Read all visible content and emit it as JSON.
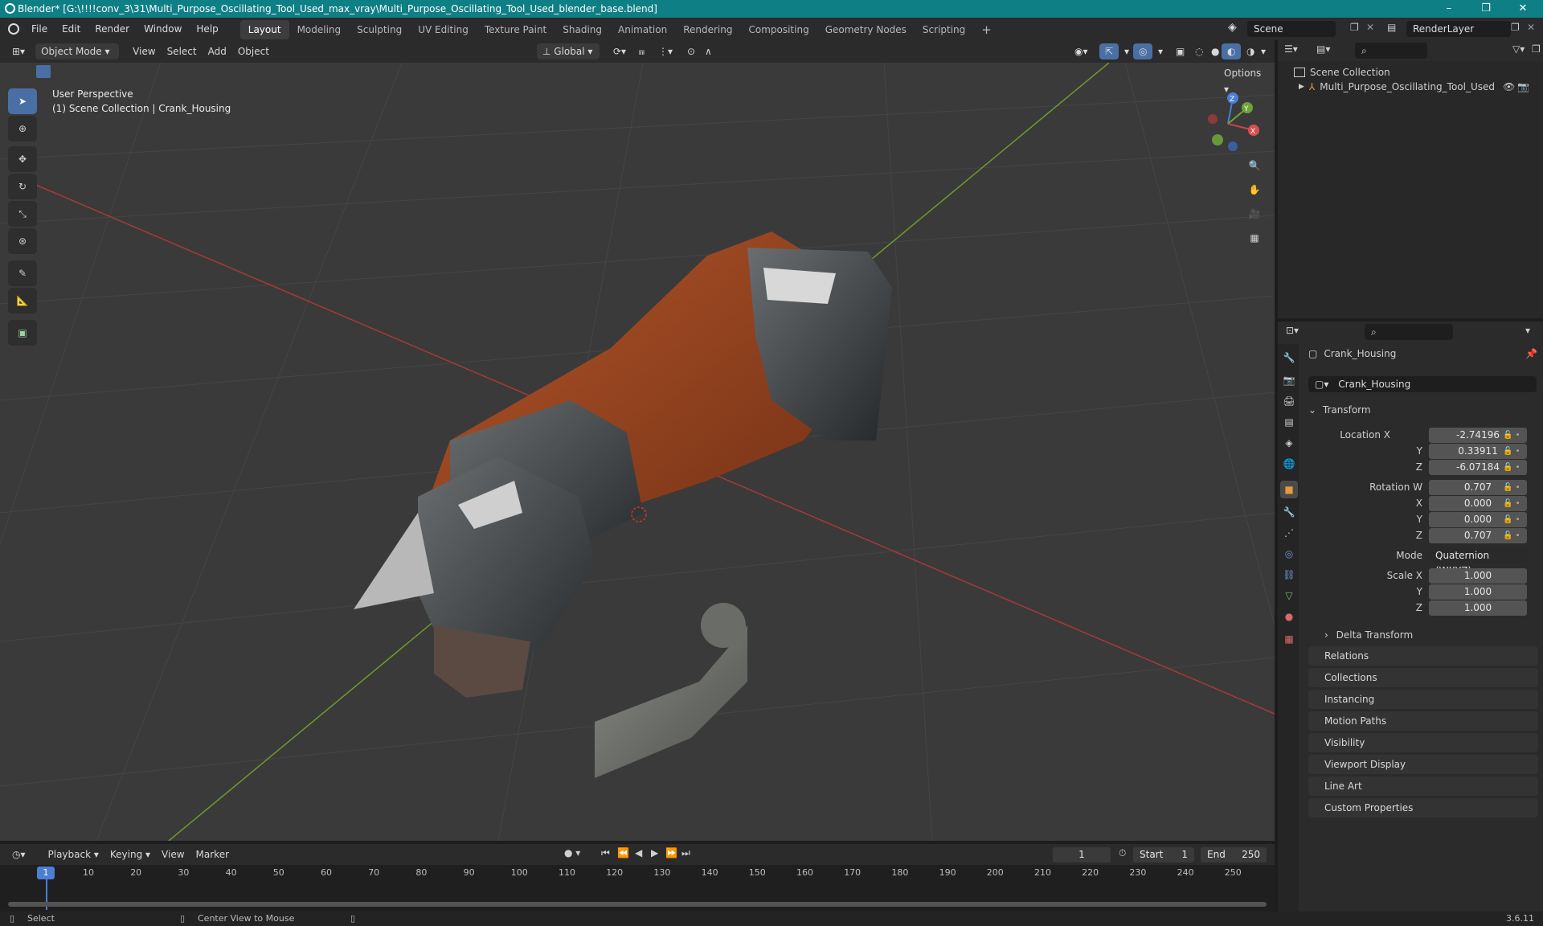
{
  "window": {
    "title": "Blender* [G:\\!!!!conv_3\\31\\Multi_Purpose_Oscillating_Tool_Used_max_vray\\Multi_Purpose_Oscillating_Tool_Used_blender_base.blend]",
    "controls": [
      "–",
      "❐",
      "✕"
    ]
  },
  "menubar": {
    "items": [
      "File",
      "Edit",
      "Render",
      "Window",
      "Help"
    ],
    "workspaces": [
      "Layout",
      "Modeling",
      "Sculpting",
      "UV Editing",
      "Texture Paint",
      "Shading",
      "Animation",
      "Rendering",
      "Compositing",
      "Geometry Nodes",
      "Scripting"
    ],
    "active_workspace": "Layout",
    "scene": "Scene",
    "view_layer": "RenderLayer"
  },
  "viewport_header": {
    "mode": "Object Mode",
    "menus": [
      "View",
      "Select",
      "Add",
      "Object"
    ],
    "orientation": "Global",
    "options": "Options"
  },
  "viewport": {
    "perspective": "User Perspective",
    "collection_info": "(1) Scene Collection | Crank_Housing",
    "gizmo": {
      "x": "X",
      "y": "Y",
      "z": "Z"
    }
  },
  "outliner": {
    "root": "Scene Collection",
    "items": [
      {
        "label": "Multi_Purpose_Oscillating_Tool_Used"
      }
    ]
  },
  "properties": {
    "object_name": "Crank_Housing",
    "datablock_name": "Crank_Housing",
    "transform_label": "Transform",
    "location": {
      "label": "Location X",
      "x": "-2.74196",
      "y": "0.33911",
      "z": "-6.07184"
    },
    "rotation": {
      "label": "Rotation W",
      "w": "0.707",
      "x": "0.000",
      "y": "0.000",
      "z": "0.707"
    },
    "mode": {
      "label": "Mode",
      "value": "Quaternion (WXYZ)"
    },
    "scale": {
      "label": "Scale X",
      "x": "1.000",
      "y": "1.000",
      "z": "1.000"
    },
    "axis_labels": {
      "y": "Y",
      "z": "Z",
      "x": "X"
    },
    "delta": "Delta Transform",
    "panels": [
      "Relations",
      "Collections",
      "Instancing",
      "Motion Paths",
      "Visibility",
      "Viewport Display",
      "Line Art",
      "Custom Properties"
    ]
  },
  "timeline": {
    "menus": [
      "Playback",
      "Keying",
      "View",
      "Marker"
    ],
    "current_frame": "1",
    "start_label": "Start",
    "start": "1",
    "end_label": "End",
    "end": "250",
    "ruler": [
      "10",
      "20",
      "30",
      "40",
      "50",
      "60",
      "70",
      "80",
      "90",
      "100",
      "110",
      "120",
      "130",
      "140",
      "150",
      "160",
      "170",
      "180",
      "190",
      "200",
      "210",
      "220",
      "230",
      "240",
      "250"
    ],
    "playhead": "1"
  },
  "statusbar": {
    "select": "Select",
    "center": "Center View to Mouse",
    "version": "3.6.11"
  }
}
